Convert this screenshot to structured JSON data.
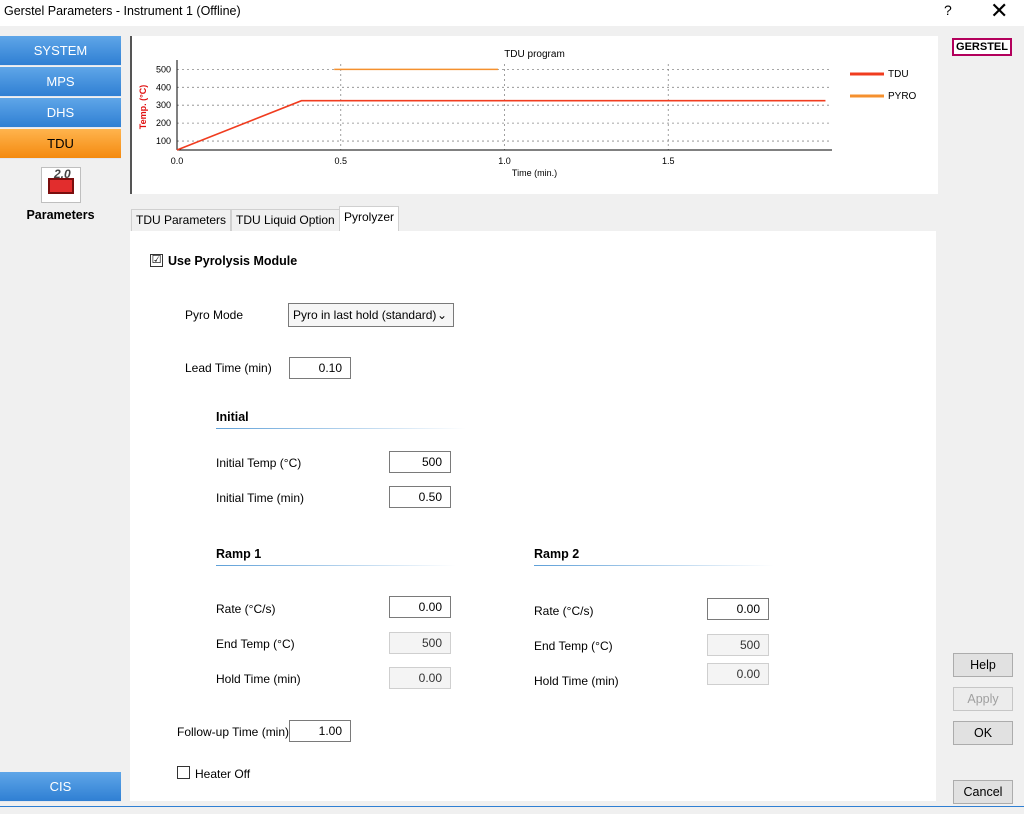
{
  "window": {
    "title": "Gerstel Parameters - Instrument 1 (Offline)",
    "help_glyph": "?",
    "close_glyph": "✕"
  },
  "nav": {
    "items": [
      {
        "label": "SYSTEM",
        "active": false
      },
      {
        "label": "MPS",
        "active": false
      },
      {
        "label": "DHS",
        "active": false
      },
      {
        "label": "TDU",
        "active": true
      }
    ],
    "bottom": "CIS",
    "icon_text": "2.0",
    "icon_label": "Parameters"
  },
  "logo": "GERSTEL",
  "chart_data": {
    "type": "line",
    "title": "TDU program",
    "xlabel": "Time (min.)",
    "ylabel": "Temp. (°C)",
    "xlim": [
      0,
      2.0
    ],
    "ylim": [
      50,
      530
    ],
    "x_ticks": [
      "0.0",
      "0.5",
      "1.0",
      "1.5"
    ],
    "x_tick_values": [
      0.0,
      0.5,
      1.0,
      1.5
    ],
    "y_ticks": [
      "100",
      "200",
      "300",
      "400",
      "500"
    ],
    "y_tick_values": [
      100,
      200,
      300,
      400,
      500
    ],
    "grid": true,
    "legend_position": "right",
    "series": [
      {
        "name": "TDU",
        "color": "#f03c1f",
        "x": [
          0.0,
          0.38,
          1.98
        ],
        "y": [
          50,
          325,
          325
        ]
      },
      {
        "name": "PYRO",
        "color": "#f5902e",
        "x": [
          0.48,
          0.98
        ],
        "y": [
          500,
          500
        ]
      }
    ]
  },
  "tabs": [
    {
      "label": "TDU Parameters",
      "active": false
    },
    {
      "label": "TDU Liquid Option",
      "active": false
    },
    {
      "label": "Pyrolyzer",
      "active": true
    }
  ],
  "form": {
    "use_pyro_label": "Use Pyrolysis Module",
    "use_pyro_checked": "☑",
    "pyro_mode_label": "Pyro Mode",
    "pyro_mode_value": "Pyro in last hold (standard)",
    "lead_time_label": "Lead Time (min)",
    "lead_time_value": "0.10",
    "initial": {
      "heading": "Initial",
      "temp_label": "Initial Temp (°C)",
      "temp_value": "500",
      "time_label": "Initial Time (min)",
      "time_value": "0.50"
    },
    "ramp1": {
      "heading": "Ramp 1",
      "rate_label": "Rate (°C/s)",
      "rate_value": "0.00",
      "end_label": "End Temp (°C)",
      "end_value": "500",
      "hold_label": "Hold Time (min)",
      "hold_value": "0.00"
    },
    "ramp2": {
      "heading": "Ramp 2",
      "rate_label": "Rate (°C/s)",
      "rate_value": "0.00",
      "end_label": "End Temp (°C)",
      "end_value": "500",
      "hold_label": "Hold Time (min)",
      "hold_value": "0.00"
    },
    "followup_label": "Follow-up Time (min)",
    "followup_value": "1.00",
    "heater_off_label": "Heater Off"
  },
  "buttons": {
    "help": "Help",
    "apply": "Apply",
    "ok": "OK",
    "cancel": "Cancel"
  }
}
